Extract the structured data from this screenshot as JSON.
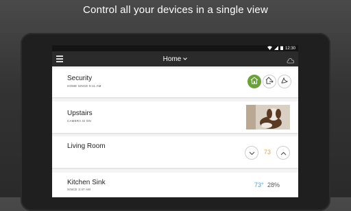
{
  "headline": "Control all your devices in a single view",
  "status_bar": {
    "time": "12:30"
  },
  "app_bar": {
    "title": "Home"
  },
  "cards": {
    "security": {
      "title": "Security",
      "subtitle": "HOME SINCE 9:11 AM"
    },
    "upstairs": {
      "title": "Upstairs",
      "subtitle": "CAMERA IS ON"
    },
    "living_room": {
      "title": "Living Room",
      "setpoint": "73"
    },
    "kitchen_sink": {
      "title": "Kitchen Sink",
      "subtitle": "SINCE 3:47 AM",
      "temperature": "73°",
      "humidity": "28%"
    }
  },
  "colors": {
    "accent_green": "#6aa13b",
    "setpoint_orange": "#e6a24c",
    "temp_blue": "#4aa0d8"
  }
}
